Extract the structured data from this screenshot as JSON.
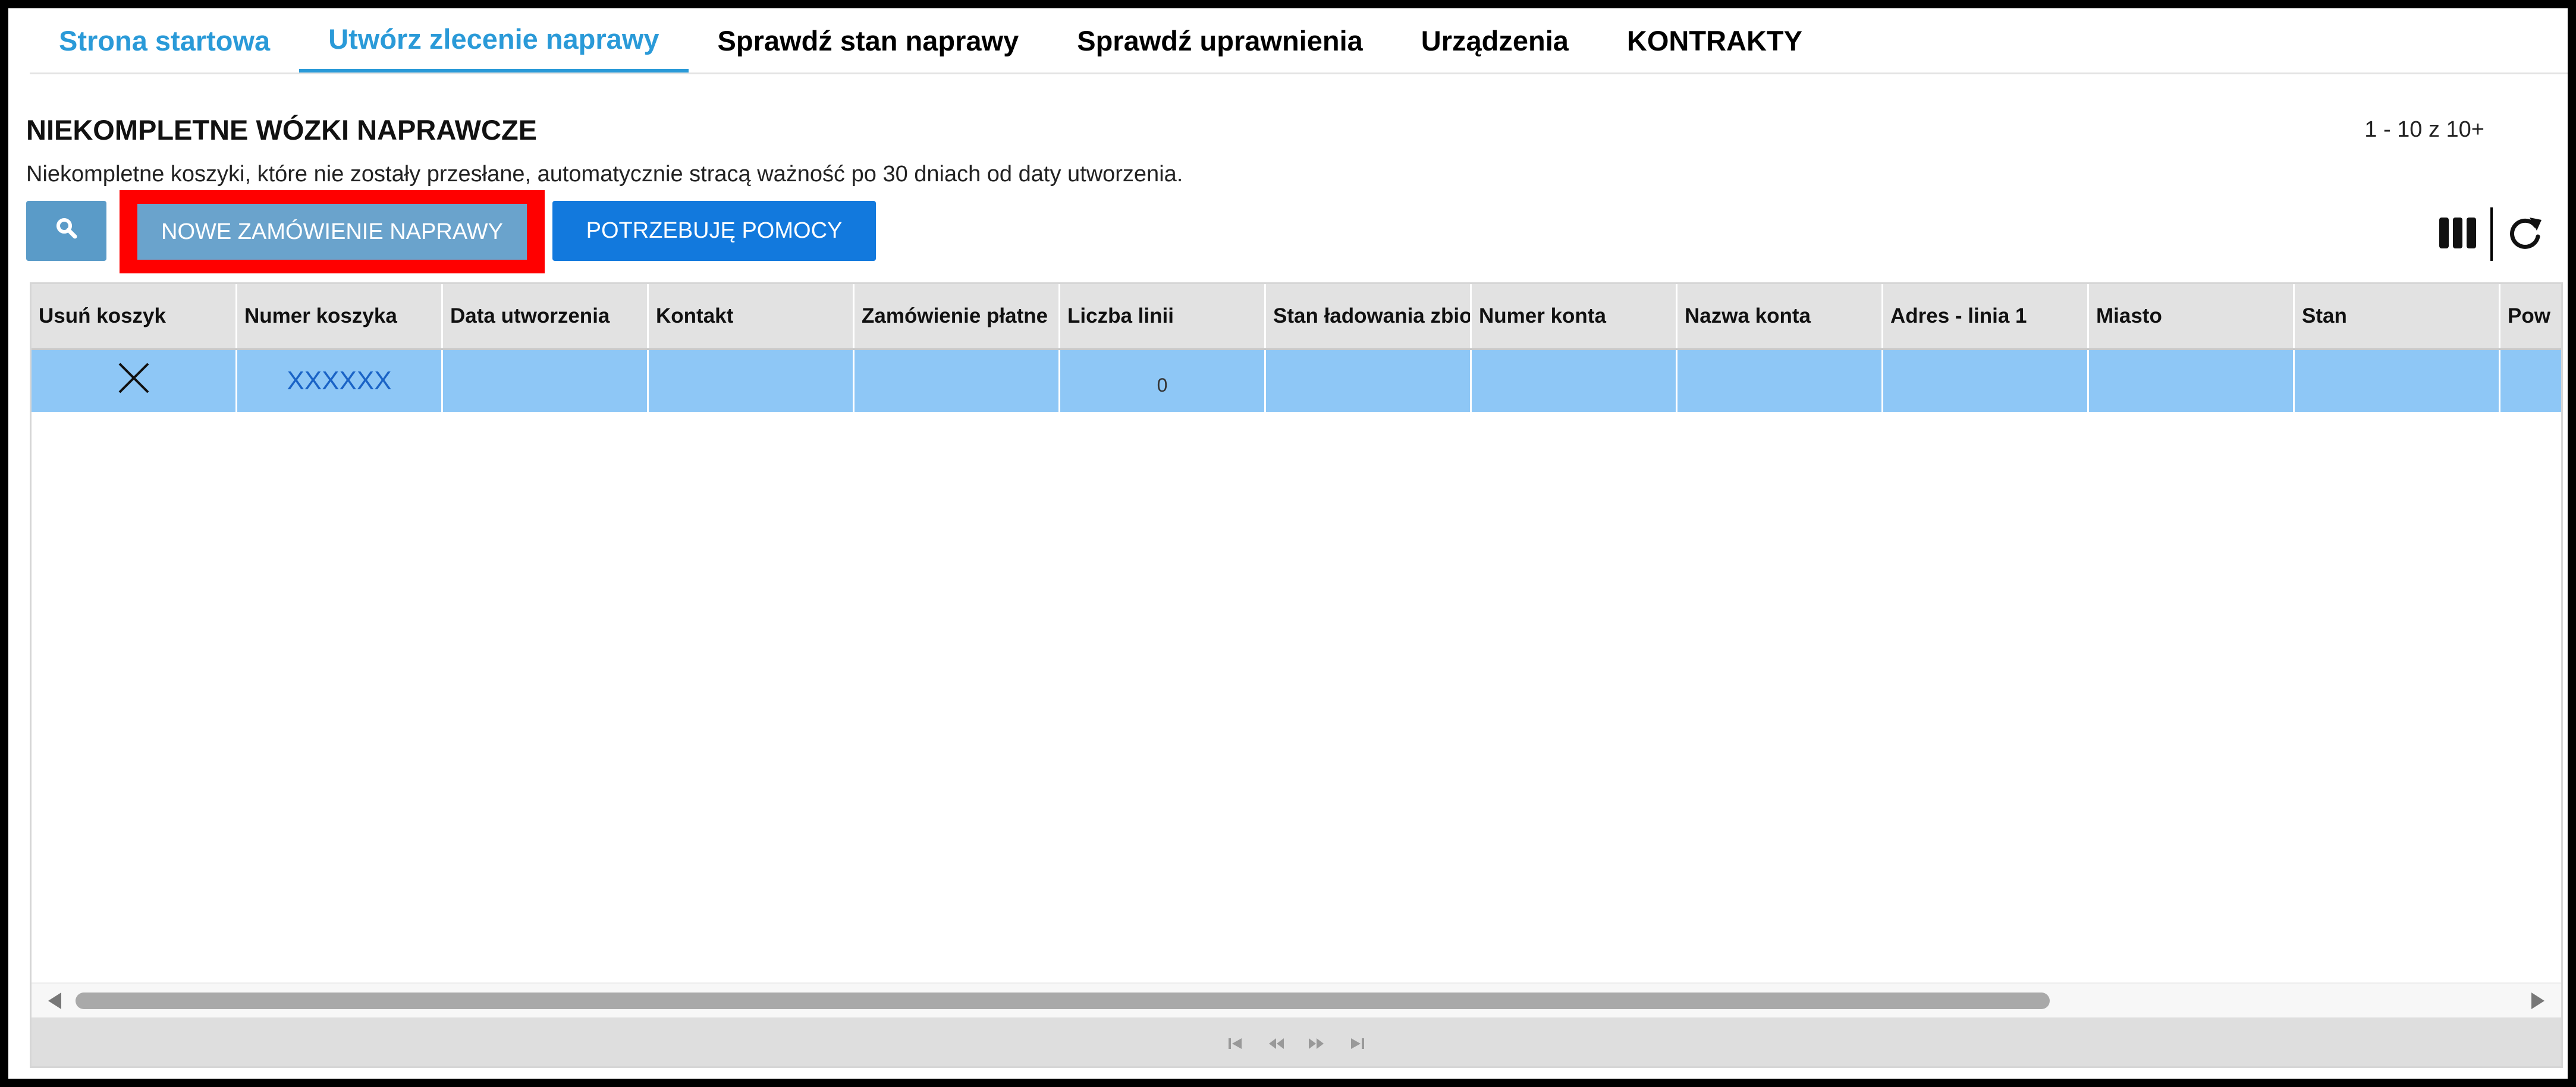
{
  "nav": {
    "tabs": [
      {
        "label": "Strona startowa",
        "state": "link"
      },
      {
        "label": "Utwórz zlecenie naprawy",
        "state": "active"
      },
      {
        "label": "Sprawdź stan naprawy",
        "state": "normal"
      },
      {
        "label": "Sprawdź uprawnienia",
        "state": "normal"
      },
      {
        "label": "Urządzenia",
        "state": "normal"
      },
      {
        "label": "KONTRAKTY",
        "state": "normal"
      }
    ]
  },
  "page": {
    "title": "NIEKOMPLETNE WÓZKI NAPRAWCZE",
    "pager": "1 - 10 z 10+",
    "subtitle": "Niekompletne koszyki, które nie zostały przesłane, automatycznie stracą ważność po 30 dniach od daty utworzenia."
  },
  "toolbar": {
    "search_icon": "search-icon",
    "new_order_label": "NOWE ZAMÓWIENIE NAPRAWY",
    "help_label": "POTRZEBUJĘ POMOCY",
    "columns_icon": "columns-icon",
    "refresh_icon": "refresh-icon"
  },
  "table": {
    "columns": [
      "Usuń koszyk",
      "Numer koszyka",
      "Data utworzenia",
      "Kontakt",
      "Zamówienie płatne",
      "Liczba linii",
      "Stan ładowania zbio",
      "Numer konta",
      "Nazwa konta",
      "Adres - linia 1",
      "Miasto",
      "Stan",
      "Pow"
    ],
    "rows": [
      {
        "delete_icon": "close-icon",
        "cart_number": "XXXXXX",
        "created": "",
        "contact": "",
        "paid": "",
        "line_count": "0",
        "load_state": "",
        "account_number": "",
        "account_name": "",
        "address": "",
        "city": "",
        "state": "",
        "extra": ""
      }
    ]
  },
  "colors": {
    "accent": "#2a9ad8",
    "selected_row": "#8ec7f6",
    "highlight": "#ff0000",
    "help_button": "#1279dd"
  }
}
